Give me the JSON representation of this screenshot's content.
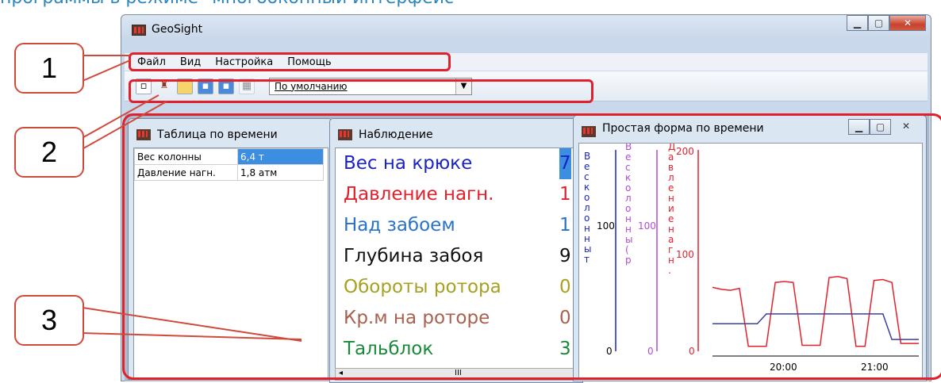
{
  "caption": "программы в режиме \"многооконный интерфейс\"",
  "window": {
    "title": "GeoSight"
  },
  "menu": [
    "Файл",
    "Вид",
    "Настройка",
    "Помощь"
  ],
  "toolbar": {
    "combo_value": "По умолчанию"
  },
  "callouts": [
    "1",
    "2",
    "3"
  ],
  "table_window": {
    "title": "Таблица по времени",
    "rows": [
      {
        "name": "Вес колонны",
        "value": "6,4 т"
      },
      {
        "name": "Давление нагн.",
        "value": "1,8 атм"
      }
    ]
  },
  "obs_window": {
    "title": "Наблюдение",
    "rows": [
      {
        "label": "Вес на крюке",
        "value": "7",
        "color": "#1a23c9"
      },
      {
        "label": "Давление нагн.",
        "value": "1",
        "color": "#e3202b"
      },
      {
        "label": "Над забоем",
        "value": "1",
        "color": "#2a72c9"
      },
      {
        "label": "Глубина забоя",
        "value": "9",
        "color": "#111111"
      },
      {
        "label": "Обороты ротора",
        "value": "0",
        "color": "#a8a020"
      },
      {
        "label": "Кр.м на роторе",
        "value": "0",
        "color": "#a8614e"
      },
      {
        "label": "Тальблок",
        "value": "3",
        "color": "#1a8a3a"
      }
    ],
    "scroll_center": "III"
  },
  "chart_window": {
    "title": "Простая форма по времени",
    "axis1_label": "Вес колонны т",
    "axis2_label": "Вес колонны (р",
    "axis3_label": "Давление нагн.",
    "axis1_ticks": [
      "100",
      "0"
    ],
    "axis2_ticks": [
      "100",
      "0"
    ],
    "axis3_ticks": [
      "200",
      "100",
      "0"
    ],
    "x_ticks": [
      "20:00",
      "21:00"
    ]
  },
  "chart_data": {
    "type": "line",
    "xlabel": "",
    "x_ticks": [
      "20:00",
      "21:00"
    ],
    "series": [
      {
        "color": "#e3202b",
        "values": [
          65,
          63,
          62,
          64,
          5,
          5,
          5,
          70,
          71,
          70,
          6,
          6,
          6,
          75,
          76,
          74,
          5,
          5,
          72,
          73,
          70,
          8,
          8,
          8
        ]
      },
      {
        "color": "#3b3fa0",
        "values": [
          28,
          28,
          28,
          28,
          28,
          28,
          38,
          38,
          38,
          38,
          38,
          38,
          38,
          38,
          38,
          38,
          38,
          38,
          38,
          38,
          12,
          12,
          12,
          12
        ]
      }
    ],
    "ylim": [
      0,
      200
    ]
  },
  "colors": {
    "highlight": "#e0202a",
    "axis_blue": "#1a23c9",
    "axis_purple": "#b24ad8",
    "axis_red": "#e3202b"
  }
}
